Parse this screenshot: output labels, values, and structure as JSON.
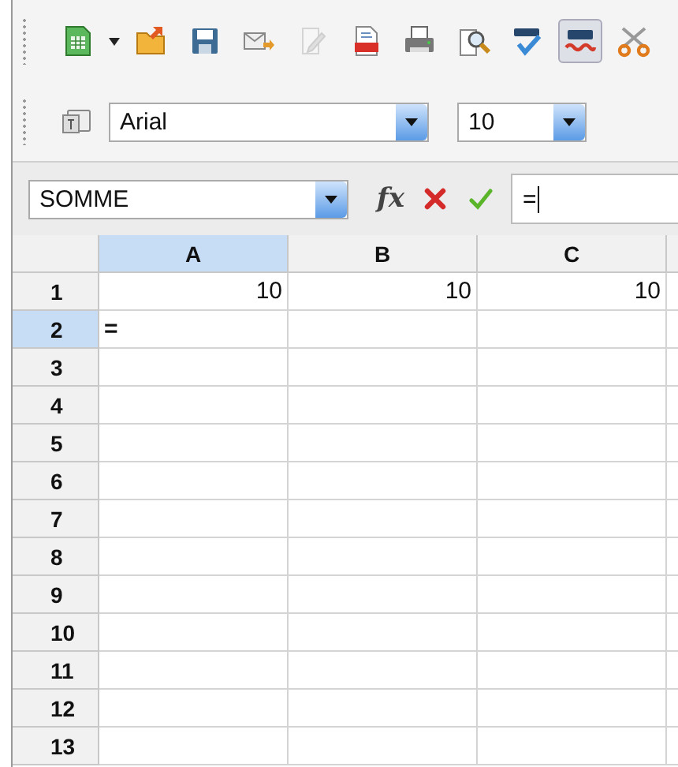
{
  "standard_toolbar": {
    "auto_spellcheck_on": true,
    "edit_mode_disabled": true
  },
  "formatting_toolbar": {
    "font_name": "Arial",
    "font_size": "10"
  },
  "formula_bar": {
    "name_box": "SOMME",
    "function_label": "fx",
    "formula": "="
  },
  "sheet": {
    "columns": [
      {
        "label": "A",
        "selected": true
      },
      {
        "label": "B",
        "selected": false
      },
      {
        "label": "C",
        "selected": false
      }
    ],
    "rows": [
      {
        "label": "1",
        "selected": false,
        "cells": [
          {
            "value": "10",
            "kind": "number"
          },
          {
            "value": "10",
            "kind": "number"
          },
          {
            "value": "10",
            "kind": "number"
          }
        ]
      },
      {
        "label": "2",
        "selected": true,
        "cells": [
          {
            "value": "=",
            "kind": "text"
          }
        ]
      },
      {
        "label": "3",
        "selected": false
      },
      {
        "label": "4",
        "selected": false
      },
      {
        "label": "5",
        "selected": false
      },
      {
        "label": "6",
        "selected": false
      },
      {
        "label": "7",
        "selected": false
      },
      {
        "label": "8",
        "selected": false
      },
      {
        "label": "9",
        "selected": false
      },
      {
        "label": "10",
        "selected": false
      },
      {
        "label": "11",
        "selected": false
      },
      {
        "label": "12",
        "selected": false
      },
      {
        "label": "13",
        "selected": false
      }
    ]
  }
}
